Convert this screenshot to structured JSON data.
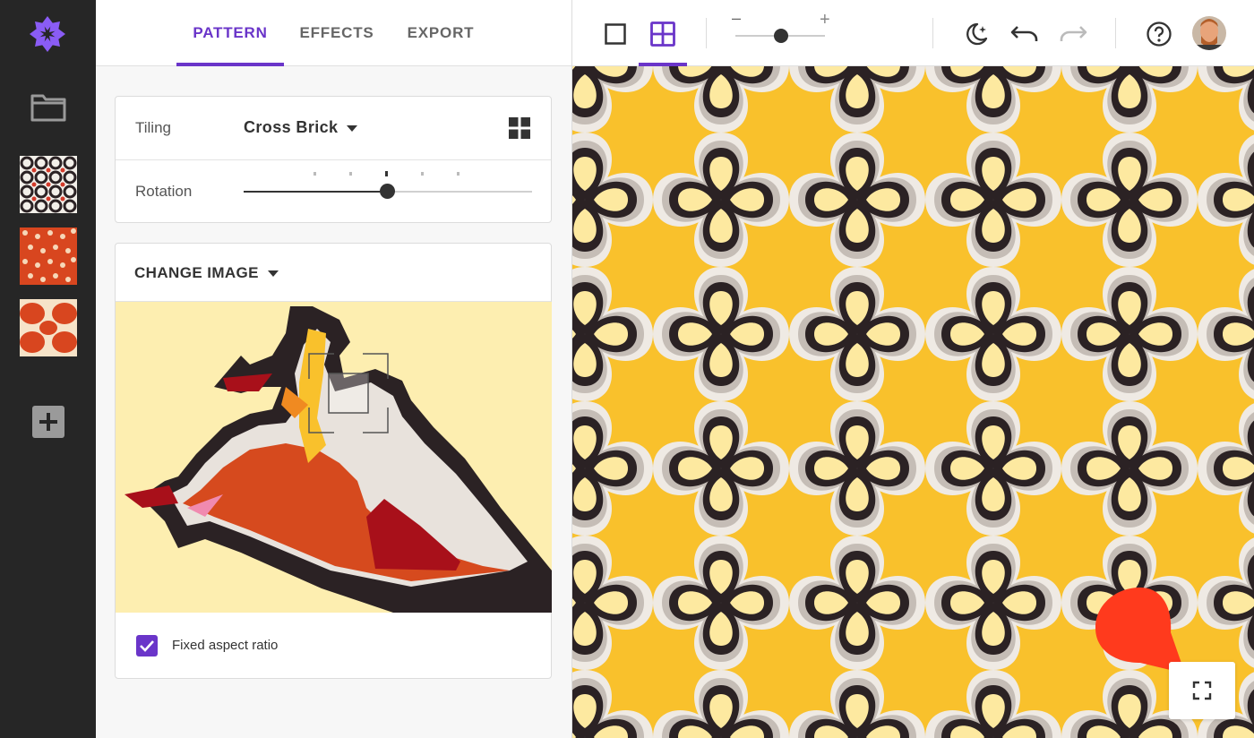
{
  "tabs": [
    {
      "label": "PATTERN",
      "active": true
    },
    {
      "label": "EFFECTS",
      "active": false
    },
    {
      "label": "EXPORT",
      "active": false
    }
  ],
  "tiling": {
    "label": "Tiling",
    "value": "Cross Brick"
  },
  "rotation": {
    "label": "Rotation",
    "value_fraction": 0.5
  },
  "change_image": {
    "label": "CHANGE IMAGE"
  },
  "fixed_aspect": {
    "label": "Fixed aspect ratio",
    "checked": true
  },
  "zoom": {
    "minus": "–",
    "plus": "+",
    "level_fraction": 0.5
  },
  "icons": {
    "logo": "logo-icon",
    "folder": "folder-icon",
    "add": "add-icon",
    "tile_view": "grid-view-icon",
    "single_view": "single-view-icon",
    "night_mode": "moon-stars-icon",
    "undo": "undo-icon",
    "redo": "redo-icon",
    "help": "help-icon",
    "fullscreen": "fullscreen-icon"
  },
  "colors": {
    "accent": "#6a35c9",
    "rail": "#262626",
    "pattern_yellow": "#f9c12c",
    "pattern_cream": "#fde9a0",
    "pattern_dark": "#2b2224",
    "pin": "#ff3a1d"
  }
}
